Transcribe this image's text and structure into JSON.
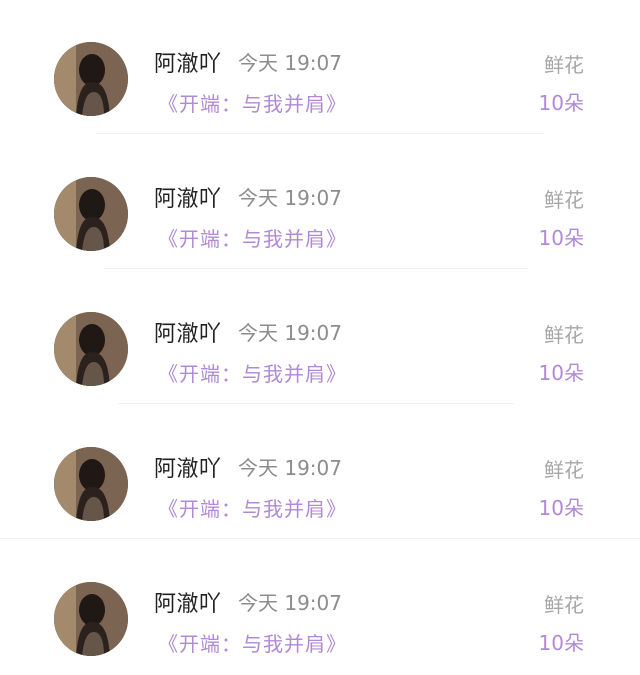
{
  "gifts": [
    {
      "user": "阿澈吖",
      "time": "今天 19:07",
      "book": "《开端：与我并肩》",
      "gift_name": "鲜花",
      "gift_count": "10朵"
    },
    {
      "user": "阿澈吖",
      "time": "今天 19:07",
      "book": "《开端：与我并肩》",
      "gift_name": "鲜花",
      "gift_count": "10朵"
    },
    {
      "user": "阿澈吖",
      "time": "今天 19:07",
      "book": "《开端：与我并肩》",
      "gift_name": "鲜花",
      "gift_count": "10朵"
    },
    {
      "user": "阿澈吖",
      "time": "今天 19:07",
      "book": "《开端：与我并肩》",
      "gift_name": "鲜花",
      "gift_count": "10朵"
    },
    {
      "user": "阿澈吖",
      "time": "今天 19:07",
      "book": "《开端：与我并肩》",
      "gift_name": "鲜花",
      "gift_count": "10朵"
    }
  ]
}
